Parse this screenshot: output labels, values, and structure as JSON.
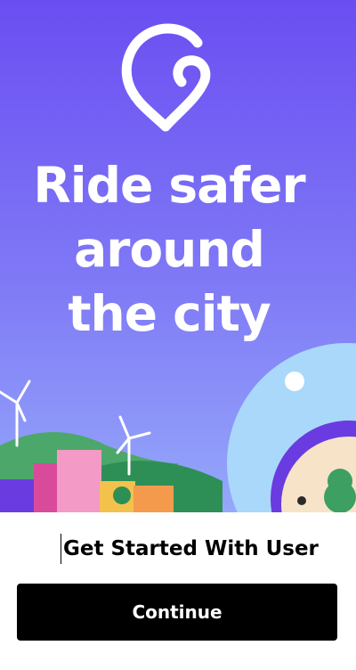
{
  "hero": {
    "headline_line1": "Ride safer",
    "headline_line2": "around",
    "headline_line3": "the city",
    "background_top_color": "#6E52F4",
    "background_bottom_color": "#8A8FF8",
    "logo_icon": "location-pin-c-logo-icon"
  },
  "cta": {
    "prompt_text": "Get Started With User",
    "continue_label": "Continue",
    "button_color": "#000000",
    "button_text_color": "#FFFFFF"
  }
}
